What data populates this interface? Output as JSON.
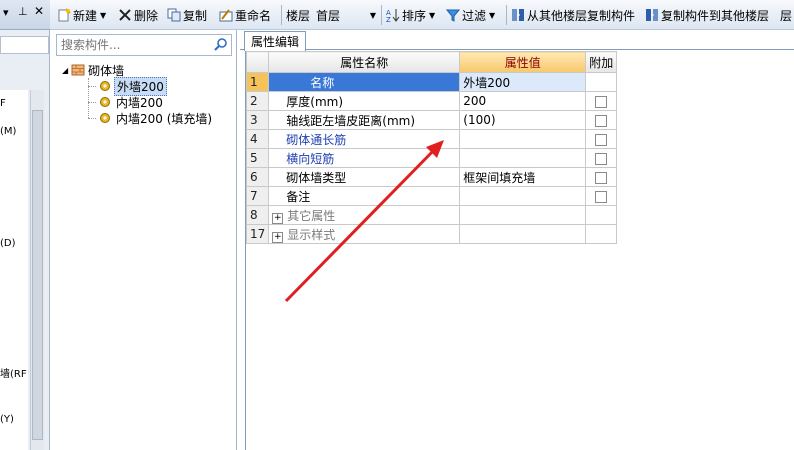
{
  "toolbar": {
    "new": "新建",
    "delete": "删除",
    "copy": "复制",
    "rename": "重命名",
    "floor_label": "楼层",
    "floor_value": "首层",
    "sort": "排序",
    "filter": "过滤",
    "copy_from_other": "从其他楼层复制构件",
    "copy_to_other": "复制构件到其他楼层"
  },
  "left_panel": {
    "fragments": [
      "(M)",
      "(D)",
      "墙(RF",
      "(Y)",
      "F"
    ]
  },
  "tree": {
    "search_placeholder": "搜索构件...",
    "root": "砌体墙",
    "items": [
      "外墙200",
      "内墙200",
      "内墙200 (填充墙)"
    ],
    "selected_index": 0
  },
  "tab": {
    "label": "属性编辑"
  },
  "grid": {
    "headers": {
      "name": "属性名称",
      "value": "属性值",
      "extra": "附加"
    },
    "rows": [
      {
        "num": "1",
        "name": "名称",
        "value": "外墙200",
        "check": false,
        "style": "selected"
      },
      {
        "num": "2",
        "name": "厚度(mm)",
        "value": "200",
        "check": true,
        "style": "normal"
      },
      {
        "num": "3",
        "name": "轴线距左墙皮距离(mm)",
        "value": "(100)",
        "check": true,
        "style": "normal"
      },
      {
        "num": "4",
        "name": "砌体通长筋",
        "value": "",
        "check": true,
        "style": "blue"
      },
      {
        "num": "5",
        "name": "横向短筋",
        "value": "",
        "check": true,
        "style": "blue"
      },
      {
        "num": "6",
        "name": "砌体墙类型",
        "value": "框架间填充墙",
        "check": true,
        "style": "normal"
      },
      {
        "num": "7",
        "name": "备注",
        "value": "",
        "check": true,
        "style": "normal"
      },
      {
        "num": "8",
        "name": "其它属性",
        "value": "",
        "check": false,
        "style": "group"
      },
      {
        "num": "17",
        "name": "显示样式",
        "value": "",
        "check": false,
        "style": "group"
      }
    ]
  },
  "colors": {
    "arrow": "#e02020",
    "header_highlight": "#f7c86a",
    "selection": "#3a78d8"
  }
}
